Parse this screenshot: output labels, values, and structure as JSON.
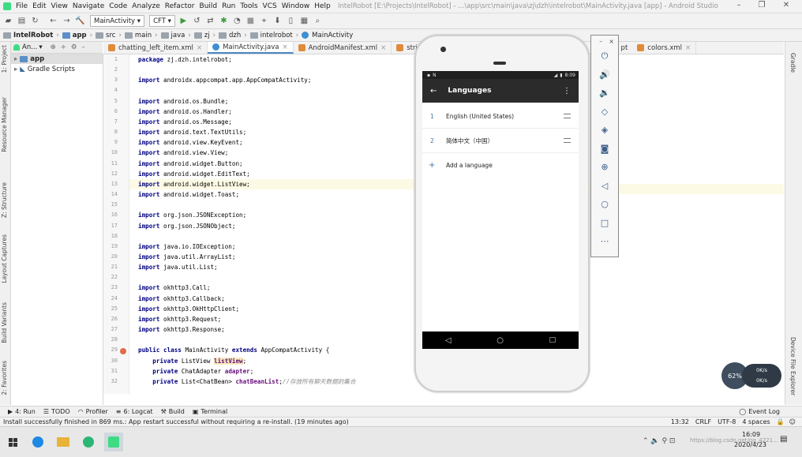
{
  "menubar": {
    "items": [
      "File",
      "Edit",
      "View",
      "Navigate",
      "Code",
      "Analyze",
      "Refactor",
      "Build",
      "Run",
      "Tools",
      "VCS",
      "Window",
      "Help"
    ],
    "title": "IntelRobot [E:\\Projects\\IntelRobot] - ...\\app\\src\\main\\java\\zj\\dzh\\intelrobot\\MainActivity.java [app] - Android Studio"
  },
  "toolbar": {
    "run_config": "MainActivity",
    "device": "CFT"
  },
  "breadcrumb": [
    "IntelRobot",
    "app",
    "src",
    "main",
    "java",
    "zj",
    "dzh",
    "intelrobot",
    "MainActivity"
  ],
  "project_panel": {
    "view_selector": "An...",
    "items": [
      "app",
      "Gradle Scripts"
    ]
  },
  "left_tool_tabs": [
    "1: Project",
    "Resource Manager",
    "Z: Structure",
    "Layout Captures",
    "Build Variants",
    "2: Favorites"
  ],
  "right_tool_tabs": [
    "Gradle",
    "Device File Explorer"
  ],
  "editor_tabs": [
    {
      "label": "chatting_left_item.xml",
      "color": "#e08b3a"
    },
    {
      "label": "MainActivity.java",
      "color": "#3d8fd1"
    },
    {
      "label": "AndroidManifest.xml",
      "color": "#e08b3a"
    },
    {
      "label": "strings.xml",
      "color": "#e08b3a"
    },
    {
      "label": "pt",
      "color": "#e08b3a"
    },
    {
      "label": "colors.xml",
      "color": "#e08b3a"
    }
  ],
  "code": {
    "line_numbers": [
      "1",
      "2",
      "3",
      "4",
      "5",
      "6",
      "7",
      "8",
      "9",
      "10",
      "11",
      "12",
      "13",
      "14",
      "15",
      "16",
      "17",
      "18",
      "19",
      "20",
      "21",
      "22",
      "23",
      "24",
      "25",
      "26",
      "27",
      "28",
      "29",
      "30",
      "31",
      "32"
    ],
    "lines": [
      "package zj.dzh.intelrobot;",
      "",
      "import androidx.appcompat.app.AppCompatActivity;",
      "",
      "import android.os.Bundle;",
      "import android.os.Handler;",
      "import android.os.Message;",
      "import android.text.TextUtils;",
      "import android.view.KeyEvent;",
      "import android.view.View;",
      "import android.widget.Button;",
      "import android.widget.EditText;",
      "import android.widget.ListView;",
      "import android.widget.Toast;",
      "",
      "import org.json.JSONException;",
      "import org.json.JSONObject;",
      "",
      "import java.io.IOException;",
      "import java.util.ArrayList;",
      "import java.util.List;",
      "",
      "import okhttp3.Call;",
      "import okhttp3.Callback;",
      "import okhttp3.OkHttpClient;",
      "import okhttp3.Request;",
      "import okhttp3.Response;",
      "",
      "public class MainActivity extends AppCompatActivity {",
      "    private ListView listView;",
      "    private ChatAdapter adapter;",
      "    private List<ChatBean> chatBeanList;//存放所有聊天数据的集合"
    ]
  },
  "emulator": {
    "status_time": "8:09",
    "appbar_title": "Languages",
    "languages": [
      {
        "num": "1",
        "name": "English (United States)"
      },
      {
        "num": "2",
        "name": "简体中文（中国）"
      }
    ],
    "add_language": "Add a language"
  },
  "bottom_tools": [
    "4: Run",
    "TODO",
    "Profiler",
    "6: Logcat",
    "Build",
    "Terminal"
  ],
  "event_log": "Event Log",
  "status": {
    "message": "Install successfully finished in 869 ms.: App restart successful without requiring a re-install. (19 minutes ago)",
    "position": "13:32",
    "line_sep": "CRLF",
    "encoding": "UTF-8",
    "indent": "4 spaces"
  },
  "net_widget": {
    "percent": "62%",
    "up": "0K/s",
    "down": "0K/s"
  },
  "taskbar": {
    "time": "16:09",
    "date": "2020/4/23",
    "watermark": "https://blog.csdn.net/qq_4221..."
  }
}
